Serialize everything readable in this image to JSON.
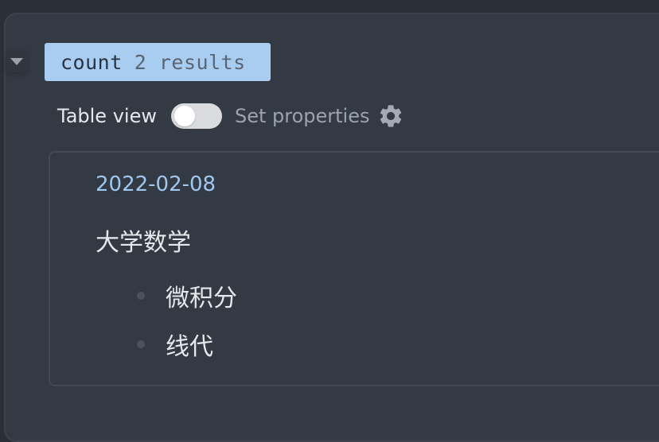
{
  "query": {
    "keyword": "count",
    "result_text": "2 results"
  },
  "controls": {
    "table_view_label": "Table view",
    "table_view_on": false,
    "set_properties_label": "Set properties"
  },
  "result": {
    "date": "2022-02-08",
    "heading": "大学数学",
    "items": [
      {
        "text": "微积分"
      },
      {
        "text": "线代"
      }
    ]
  },
  "icons": {
    "collapse": "chevron-down-icon",
    "settings": "gear-icon"
  },
  "colors": {
    "query_chip_bg": "#a9cdf1",
    "date_link": "#9fc7ef",
    "panel_bg": "#343a44"
  }
}
